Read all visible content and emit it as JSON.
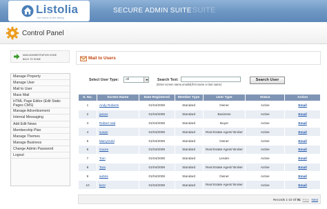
{
  "header": {
    "logo_text": "Listolia",
    "logo_tagline": "the home is the listing",
    "suite_title": "SECURE ADMIN SUITE",
    "suite_ghost": "SUITE"
  },
  "control_panel": {
    "title": "Control Panel"
  },
  "sidebar": {
    "home_link": {
      "line1": "MAIN ADMINISTRATION HOME",
      "line2": "BACK TO HOME"
    },
    "items": [
      {
        "label": "Manage Property"
      },
      {
        "label": "Manage User"
      },
      {
        "label": "Mail to User"
      },
      {
        "label": "Mass Mail"
      },
      {
        "label": "HTML Page Editor (Edit Static Pages CMS)"
      },
      {
        "label": "Manage Advertisement"
      },
      {
        "label": "Internal Messaging"
      },
      {
        "label": "Add Edit News"
      },
      {
        "label": "Membership Plan"
      },
      {
        "label": "Manage Themes"
      },
      {
        "label": "Manage Business"
      },
      {
        "label": "Change Admin Password"
      },
      {
        "label": "Logout"
      }
    ]
  },
  "main": {
    "title": "Mail to Users",
    "filter": {
      "user_type_label": "Select User Type:",
      "user_type_value": "All",
      "search_label": "Search Text:",
      "search_value": "",
      "search_hint": "(Enter screen name,emailid,first name or last name)",
      "search_button": "Search User"
    },
    "table": {
      "headers": [
        "S. No.",
        "Screen Name",
        "Date Registered",
        "Member Type",
        "User Type",
        "Status",
        "Action"
      ],
      "rows": [
        {
          "sno": "1",
          "name": "Andy Roberts",
          "date": "01/04/2008",
          "member": "Standard",
          "user_type": "Owner",
          "status": "Active",
          "action": "Email"
        },
        {
          "sno": "2",
          "name": "james",
          "date": "01/04/2008",
          "member": "Standard",
          "user_type": "Business",
          "status": "Active",
          "action": "Email"
        },
        {
          "sno": "3",
          "name": "Robert Vad",
          "date": "01/04/2008",
          "member": "Standard",
          "user_type": "Buyer",
          "status": "Active",
          "action": "Email"
        },
        {
          "sno": "4",
          "name": "susan",
          "date": "01/04/2008",
          "member": "Standard",
          "user_type": "Real Estate Agent/ Broker",
          "status": "Active",
          "action": "Email"
        },
        {
          "sno": "5",
          "name": "MarryGold",
          "date": "01/04/2008",
          "member": "Standard",
          "user_type": "Owner",
          "status": "Active",
          "action": "Email"
        },
        {
          "sno": "6",
          "name": "moore",
          "date": "01/04/2008",
          "member": "Standard",
          "user_type": "Real Estate Agent/ Broker",
          "status": "Active",
          "action": "Email"
        },
        {
          "sno": "7",
          "name": "Tom",
          "date": "01/04/2008",
          "member": "Standard",
          "user_type": "Lender",
          "status": "Active",
          "action": "Email"
        },
        {
          "sno": "8",
          "name": "Tara",
          "date": "01/04/2008",
          "member": "Standard",
          "user_type": "Real Estate Agent/ Broker",
          "status": "Active",
          "action": "Email"
        },
        {
          "sno": "9",
          "name": "aubrie",
          "date": "01/04/2008",
          "member": "Standard",
          "user_type": "Owner",
          "status": "Active",
          "action": "Email"
        },
        {
          "sno": "10",
          "name": "kent",
          "date": "01/04/2008",
          "member": "Standard",
          "user_type": "Real Estate Agent/ Broker",
          "status": "Active",
          "action": "Email"
        }
      ]
    },
    "footer": {
      "records_prefix": "Records",
      "records_range": "1-10",
      "records_of": "Of",
      "records_total": "81",
      "prev": "Prev",
      "next": "Next"
    }
  },
  "colors": {
    "header_blue": "#6f98c4",
    "table_header": "#7f94b4",
    "row_alt": "#e9eef5",
    "link_blue": "#1f56a8",
    "title_orange": "#c2440e"
  },
  "icons": [
    "house-logo-icon",
    "gear-icon",
    "green-arrow-icon",
    "mail-icon",
    "dropdown-caret-icon"
  ]
}
